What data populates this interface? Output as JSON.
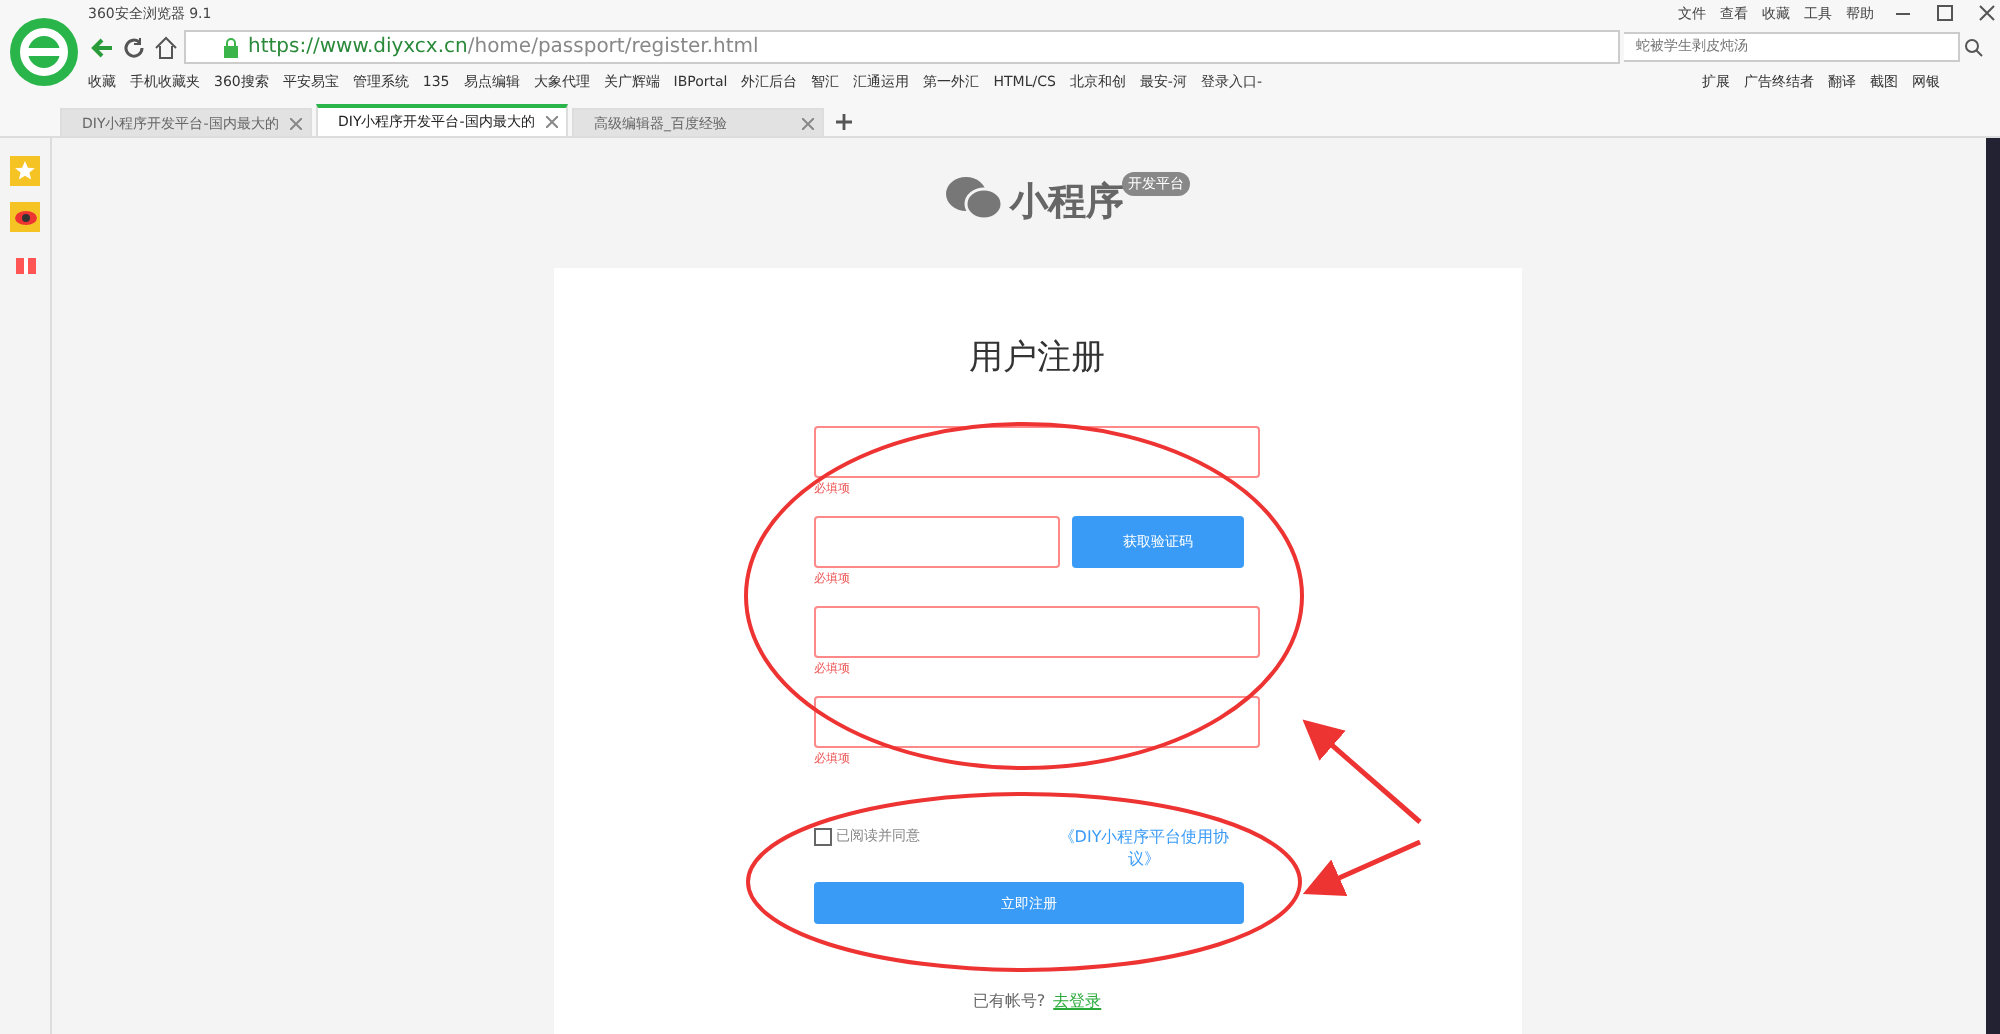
{
  "browser": {
    "title": "360安全浏览器 9.1",
    "menu": [
      "文件",
      "查看",
      "收藏",
      "工具",
      "帮助"
    ],
    "url_host": "https://www.diyxcx.cn",
    "url_path": "/home/passport/register.html",
    "search": {
      "placeholder": "蛇被学生剥皮炖汤"
    }
  },
  "bookmarks": [
    "收藏",
    "手机收藏夹",
    "360搜索",
    "平安易宝",
    "管理系统",
    "135",
    "易点编辑",
    "大象代理",
    "关广辉端",
    "IBPortal",
    "外汇后台",
    "智汇",
    "汇通运用",
    "第一外汇",
    "HTML/CS",
    "北京和创",
    "最安-河",
    "登录入口-"
  ],
  "extensions": [
    "扩展",
    "广告终结者",
    "翻译",
    "截图",
    "网银"
  ],
  "tabs": [
    {
      "label": "DIY小程序开发平台-国内最大的",
      "selected": false
    },
    {
      "label": "DIY小程序开发平台-国内最大的",
      "selected": true
    },
    {
      "label": "高级编辑器_百度经验",
      "selected": false
    }
  ],
  "page": {
    "logo": "小程序",
    "logo_badge": "开发平台",
    "title": "用户注册",
    "fields": [
      {
        "kind": "full",
        "error": true,
        "hint": "必填项"
      },
      {
        "kind": "code",
        "error": true,
        "hint": "必填项",
        "button": "获取验证码"
      },
      {
        "kind": "full",
        "error": true,
        "hint": "必填项"
      },
      {
        "kind": "full",
        "error": true,
        "hint": "必填项"
      }
    ],
    "agree": {
      "label": "已阅读并同意",
      "checked": false,
      "link": "《DIY小程序平台使用协议》"
    },
    "submit": "立即注册",
    "login_prompt": "已有帐号?",
    "login_link": "去登录"
  }
}
